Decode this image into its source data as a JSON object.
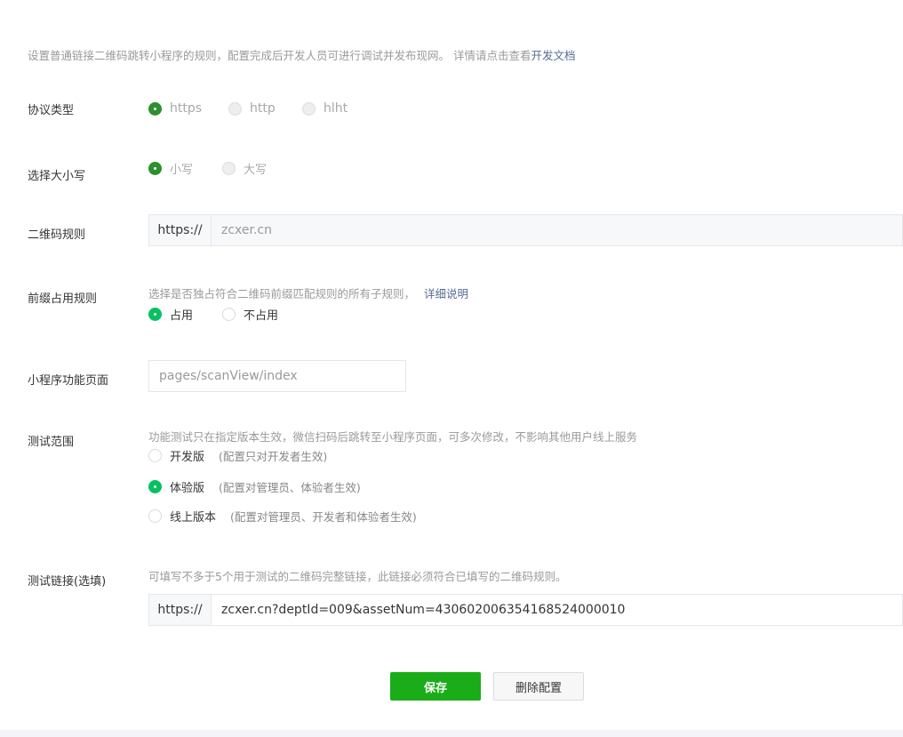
{
  "intro": {
    "text": "设置普通链接二维码跳转小程序的规则，配置完成后开发人员可进行调试并发布现网。 详情请点击查看",
    "link": "开发文档"
  },
  "protocol": {
    "label": "协议类型",
    "options": [
      "https",
      "http",
      "hlht"
    ],
    "selected": "https"
  },
  "case": {
    "label": "选择大小写",
    "options": [
      "小写",
      "大写"
    ],
    "selected": "小写"
  },
  "qr_rule": {
    "label": "二维码规则",
    "prefix": "https://",
    "value": "zcxer.cn"
  },
  "prefix_rule": {
    "label": "前缀占用规则",
    "hint": "选择是否独占符合二维码前缀匹配规则的所有子规则，",
    "hint_link": "详细说明",
    "options": [
      "占用",
      "不占用"
    ],
    "selected": "占用"
  },
  "page": {
    "label": "小程序功能页面",
    "placeholder": "pages/scanView/index"
  },
  "test_scope": {
    "label": "测试范围",
    "hint": "功能测试只在指定版本生效，微信扫码后跳转至小程序页面，可多次修改，不影响其他用户线上服务",
    "options": [
      {
        "label": "开发版",
        "note": "(配置只对开发者生效)"
      },
      {
        "label": "体验版",
        "note": "(配置对管理员、体验者生效)"
      },
      {
        "label": "线上版本",
        "note": "(配置对管理员、开发者和体验者生效)"
      }
    ],
    "selected": "体验版"
  },
  "test_link": {
    "label": "测试链接(选填)",
    "hint": "可填写不多于5个用于测试的二维码完整链接，此链接必须符合已填写的二维码规则。",
    "prefix": "https://",
    "value": "zcxer.cn?deptId=009&assetNum=43060200635416852400001​0"
  },
  "buttons": {
    "save": "保存",
    "delete": "删除配置"
  }
}
